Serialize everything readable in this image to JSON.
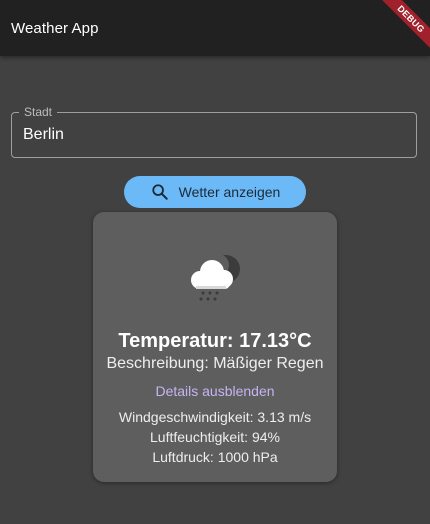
{
  "appbar": {
    "title": "Weather App"
  },
  "debug_banner": "DEBUG",
  "city_field": {
    "label": "Stadt",
    "value": "Berlin"
  },
  "search_button": {
    "label": "Wetter anzeigen",
    "icon": "search-icon"
  },
  "weather_card": {
    "icon": "cloud-rain-night-icon",
    "temperature": "Temperatur: 17.13°C",
    "description": "Beschreibung: Mäßiger Regen",
    "toggle_label": "Details ausblenden",
    "details": {
      "wind": "Windgeschwindigkeit: 3.13 m/s",
      "humidity": "Luftfeuchtigkeit: 94%",
      "pressure": "Luftdruck: 1000 hPa"
    }
  },
  "colors": {
    "background": "#414141",
    "appbar": "#212121",
    "button": "#6cb9f7",
    "card": "#5e5e5e",
    "link": "#c7b3f2",
    "debug_ribbon": "#a0212b"
  }
}
